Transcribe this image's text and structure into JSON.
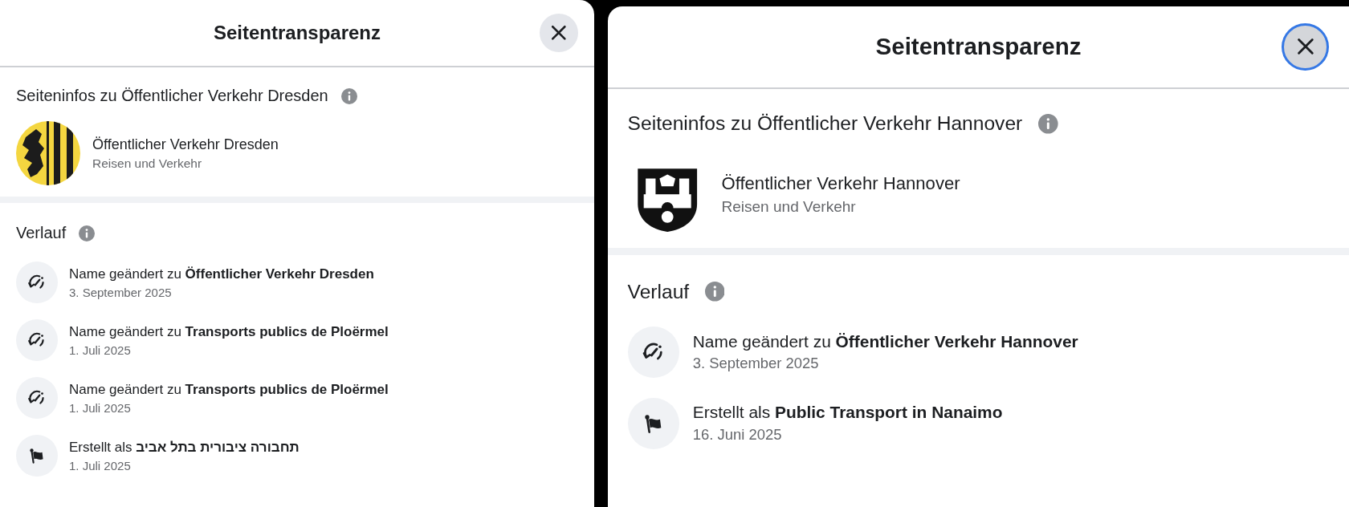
{
  "panels": [
    {
      "title": "Seitentransparenz",
      "close_button": {
        "focused": false
      },
      "page_info": {
        "heading": "Seiteninfos zu Öffentlicher Verkehr Dresden",
        "name": "Öffentlicher Verkehr Dresden",
        "category": "Reisen und Verkehr"
      },
      "history": {
        "heading": "Verlauf",
        "items": [
          {
            "kind": "rename",
            "text": "Name geändert zu **Öffentlicher Verkehr Dresden**",
            "date": "3. September 2025"
          },
          {
            "kind": "rename",
            "text": "Name geändert zu **Transports publics de Ploërmel**",
            "date": "1. Juli 2025"
          },
          {
            "kind": "rename",
            "text": "Name geändert zu **Transports publics de Ploërmel**",
            "date": "1. Juli 2025"
          },
          {
            "kind": "created",
            "text": "Erstellt als **תחבורה ציבורית בתל אביב**",
            "date": "1. Juli 2025"
          }
        ]
      }
    },
    {
      "title": "Seitentransparenz",
      "close_button": {
        "focused": true
      },
      "page_info": {
        "heading": "Seiteninfos zu Öffentlicher Verkehr Hannover",
        "name": "Öffentlicher Verkehr Hannover",
        "category": "Reisen und Verkehr"
      },
      "history": {
        "heading": "Verlauf",
        "items": [
          {
            "kind": "rename",
            "text": "Name geändert zu **Öffentlicher Verkehr Hannover**",
            "date": "3. September 2025"
          },
          {
            "kind": "created",
            "text": "Erstellt als **Public Transport in Nanaimo**",
            "date": "16. Juni 2025"
          }
        ]
      }
    }
  ]
}
